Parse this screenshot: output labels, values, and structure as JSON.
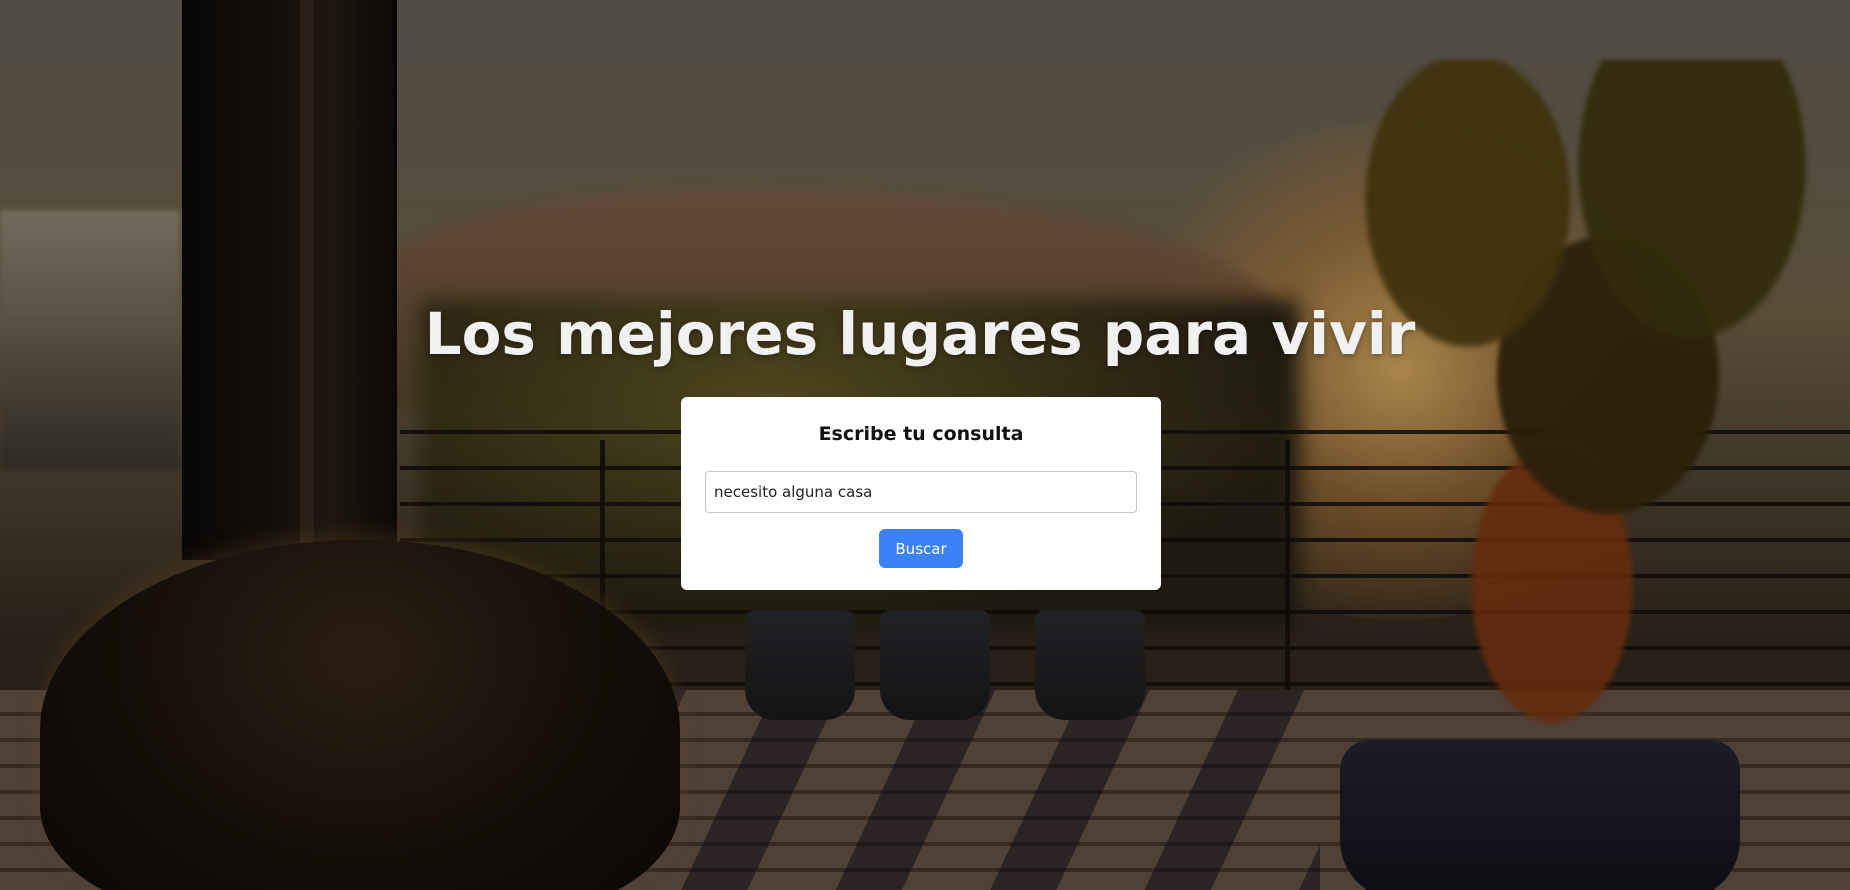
{
  "hero": {
    "title": "Los mejores lugares para vivir"
  },
  "search": {
    "heading": "Escribe tu consulta",
    "input_value": "necesito alguna casa",
    "button_label": "Buscar"
  },
  "colors": {
    "accent": "#3b82f6",
    "card_background": "#ffffff",
    "title_text": "#f1f1f1"
  }
}
